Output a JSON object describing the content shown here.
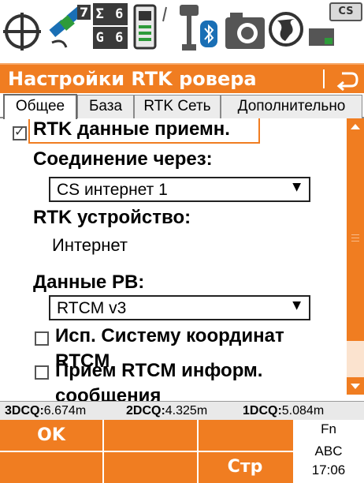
{
  "status_bar": {
    "icons": [
      "crosshair-icon",
      "satellite-icon",
      "gnss-counts",
      "battery-icon",
      "antenna-icon",
      "bluetooth-icon",
      "camera-icon",
      "globe-icon",
      "memory-card-icon",
      "cs-badge"
    ],
    "gnss_count_top": "Σ 6",
    "gnss_count_bottom": "G 6",
    "satellite_count": "7",
    "cs_label": "CS"
  },
  "title": "Настройки RTK ровера",
  "tabs": [
    {
      "label": "Общее",
      "active": true
    },
    {
      "label": "База",
      "active": false
    },
    {
      "label": "RTK Сеть",
      "active": false
    },
    {
      "label": "Дополнительно",
      "active": false
    }
  ],
  "form": {
    "rtk_data_label": "RTK данные приемн.",
    "rtk_data_checked": true,
    "connection_label": "Соединение через:",
    "connection_value": "CS интернет 1",
    "rtk_device_label": "RTK устройство:",
    "rtk_device_value": "Интернет",
    "rtk_data_format_label": "Данные РВ:",
    "rtk_data_format_value": "RTCM v3",
    "use_rtcm_coord_label_line1": "Исп. Систему координат",
    "use_rtcm_coord_label_line2": "RTCM",
    "use_rtcm_coord_checked": false,
    "receive_rtcm_msg_label_line1": "Прием RTCM информ.",
    "receive_rtcm_msg_label_line2": "сообщения",
    "receive_rtcm_msg_checked": false
  },
  "quality": [
    {
      "label": "3DCQ:",
      "value": "6.674m"
    },
    {
      "label": "2DCQ:",
      "value": "4.325m"
    },
    {
      "label": "1DCQ:",
      "value": "5.084m"
    }
  ],
  "softkeys": {
    "f1": "OK",
    "f6": "Стр",
    "fn_label": "Fn",
    "input_mode": "ABC",
    "time": "17:06"
  },
  "colors": {
    "accent": "#f07d21",
    "scroll_track": "#fbe3cf"
  }
}
